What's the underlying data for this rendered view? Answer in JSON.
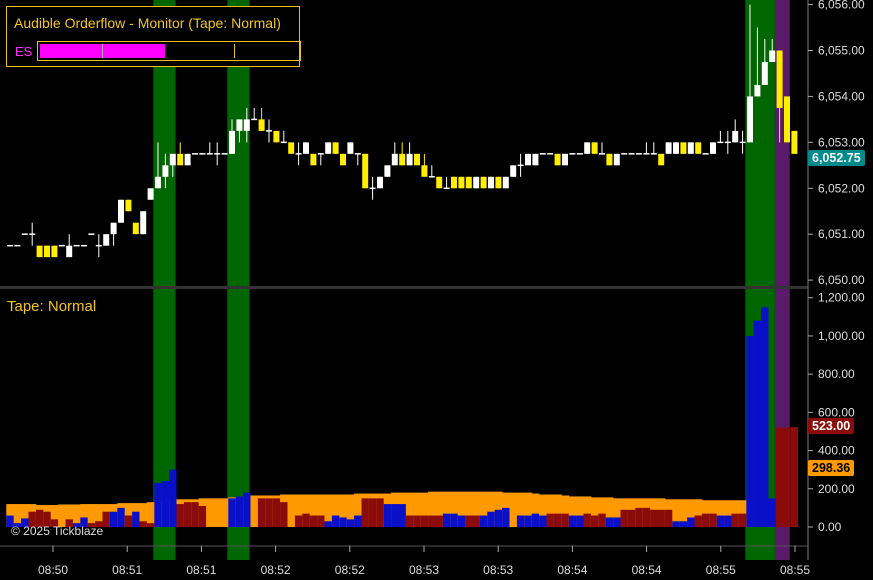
{
  "monitor": {
    "title": "Audible Orderflow - Monitor (Tape: Normal)",
    "symbol": "ES",
    "level": 0.48
  },
  "tape_label": "Tape: Normal",
  "copyright": "© 2025 Tickblaze",
  "last_price_tag": "6,052.75",
  "volume_tag_high": "523.00",
  "volume_tag_avg": "298.36",
  "colors": {
    "background": "#000000",
    "up_candle": "#ffffff",
    "down_candle": "#ffee00",
    "highlight_green": "#006600",
    "highlight_purple": "#5a1a6a",
    "volume_buy": "#0a10c8",
    "volume_sell": "#8b0a0a",
    "volume_average": "#ff9900",
    "last_price": "#008a8a"
  },
  "chart_data": [
    {
      "type": "candlestick",
      "title": "",
      "y_ticks": [
        "6,056.00",
        "6,055.00",
        "6,054.00",
        "6,053.00",
        "6,052.00",
        "6,051.00",
        "6,050.00"
      ],
      "ylim": [
        6049.85,
        6056.1
      ],
      "x_ticks": [
        "08:50",
        "08:51",
        "08:51",
        "08:52",
        "08:52",
        "08:53",
        "08:53",
        "08:54",
        "08:54",
        "08:55",
        "08:55"
      ],
      "highlight_bands": [
        {
          "start": 20,
          "end": 22,
          "color": "green"
        },
        {
          "start": 30,
          "end": 32,
          "color": "green"
        },
        {
          "start": 100,
          "end": 103,
          "color": "green"
        },
        {
          "start": 104,
          "end": 105,
          "color": "purple"
        }
      ],
      "candles": [
        [
          6050.75,
          6050.75,
          6050.75,
          6050.75
        ],
        [
          6050.75,
          6050.75,
          6050.75,
          6050.75
        ],
        [
          6051.0,
          6051.0,
          6051.0,
          6051.0
        ],
        [
          6051.0,
          6051.25,
          6050.75,
          6051.0
        ],
        [
          6050.75,
          6050.75,
          6050.5,
          6050.5
        ],
        [
          6050.75,
          6050.75,
          6050.5,
          6050.5
        ],
        [
          6050.75,
          6050.75,
          6050.5,
          6050.5
        ],
        [
          6050.75,
          6050.75,
          6050.75,
          6050.75
        ],
        [
          6050.5,
          6051.0,
          6050.5,
          6050.75
        ],
        [
          6050.75,
          6050.75,
          6050.75,
          6050.75
        ],
        [
          6050.75,
          6050.75,
          6050.75,
          6050.75
        ],
        [
          6051.0,
          6051.0,
          6051.0,
          6051.0
        ],
        [
          6050.75,
          6051.0,
          6050.5,
          6050.75
        ],
        [
          6050.75,
          6051.0,
          6050.75,
          6051.0
        ],
        [
          6051.0,
          6051.25,
          6050.75,
          6051.25
        ],
        [
          6051.25,
          6051.75,
          6051.25,
          6051.75
        ],
        [
          6051.75,
          6051.75,
          6051.5,
          6051.5
        ],
        [
          6051.25,
          6051.25,
          6051.0,
          6051.0
        ],
        [
          6051.0,
          6051.5,
          6051.0,
          6051.5
        ],
        [
          6051.75,
          6052.0,
          6051.75,
          6052.0
        ],
        [
          6052.0,
          6053.0,
          6052.0,
          6052.25
        ],
        [
          6052.25,
          6052.75,
          6052.0,
          6052.5
        ],
        [
          6052.5,
          6052.75,
          6052.25,
          6052.75
        ],
        [
          6052.75,
          6053.0,
          6052.5,
          6052.5
        ],
        [
          6052.5,
          6052.75,
          6052.5,
          6052.75
        ],
        [
          6052.75,
          6052.75,
          6052.75,
          6052.75
        ],
        [
          6052.75,
          6052.75,
          6052.75,
          6052.75
        ],
        [
          6052.75,
          6053.0,
          6052.75,
          6052.75
        ],
        [
          6052.75,
          6053.0,
          6052.5,
          6052.75
        ],
        [
          6052.75,
          6052.75,
          6052.75,
          6052.75
        ],
        [
          6052.75,
          6053.5,
          6052.75,
          6053.25
        ],
        [
          6053.25,
          6053.5,
          6053.0,
          6053.5
        ],
        [
          6053.25,
          6053.75,
          6053.0,
          6053.5
        ],
        [
          6053.5,
          6053.75,
          6053.5,
          6053.5
        ],
        [
          6053.5,
          6053.75,
          6053.25,
          6053.25
        ],
        [
          6053.25,
          6053.5,
          6053.0,
          6053.25
        ],
        [
          6053.25,
          6053.25,
          6053.0,
          6053.0
        ],
        [
          6053.0,
          6053.25,
          6053.0,
          6053.0
        ],
        [
          6053.0,
          6053.0,
          6052.75,
          6052.75
        ],
        [
          6052.75,
          6053.0,
          6052.5,
          6052.75
        ],
        [
          6052.75,
          6053.0,
          6052.75,
          6053.0
        ],
        [
          6052.75,
          6052.75,
          6052.5,
          6052.5
        ],
        [
          6052.75,
          6052.75,
          6052.5,
          6052.75
        ],
        [
          6052.75,
          6053.0,
          6052.75,
          6053.0
        ],
        [
          6053.0,
          6053.0,
          6052.75,
          6052.75
        ],
        [
          6052.75,
          6052.75,
          6052.5,
          6052.5
        ],
        [
          6052.75,
          6053.0,
          6052.75,
          6053.0
        ],
        [
          6052.75,
          6052.75,
          6052.5,
          6052.75
        ],
        [
          6052.75,
          6052.75,
          6052.0,
          6052.0
        ],
        [
          6052.0,
          6052.25,
          6051.75,
          6052.0
        ],
        [
          6052.0,
          6052.25,
          6052.0,
          6052.25
        ],
        [
          6052.25,
          6052.5,
          6052.25,
          6052.5
        ],
        [
          6052.5,
          6053.0,
          6052.5,
          6052.75
        ],
        [
          6052.75,
          6053.0,
          6052.5,
          6052.5
        ],
        [
          6052.5,
          6053.0,
          6052.5,
          6052.75
        ],
        [
          6052.75,
          6052.75,
          6052.5,
          6052.5
        ],
        [
          6052.5,
          6052.75,
          6052.25,
          6052.25
        ],
        [
          6052.25,
          6052.5,
          6052.25,
          6052.25
        ],
        [
          6052.25,
          6052.25,
          6052.0,
          6052.0
        ],
        [
          6052.0,
          6052.25,
          6052.0,
          6052.0
        ],
        [
          6052.25,
          6052.25,
          6052.0,
          6052.0
        ],
        [
          6052.25,
          6052.25,
          6052.0,
          6052.0
        ],
        [
          6052.25,
          6052.25,
          6052.0,
          6052.0
        ],
        [
          6052.0,
          6052.25,
          6052.0,
          6052.25
        ],
        [
          6052.25,
          6052.25,
          6052.0,
          6052.0
        ],
        [
          6052.0,
          6052.25,
          6052.0,
          6052.25
        ],
        [
          6052.25,
          6052.25,
          6052.0,
          6052.0
        ],
        [
          6052.0,
          6052.25,
          6052.0,
          6052.25
        ],
        [
          6052.25,
          6052.5,
          6052.25,
          6052.5
        ],
        [
          6052.5,
          6052.75,
          6052.25,
          6052.5
        ],
        [
          6052.5,
          6052.75,
          6052.5,
          6052.75
        ],
        [
          6052.5,
          6052.75,
          6052.5,
          6052.75
        ],
        [
          6052.75,
          6052.75,
          6052.75,
          6052.75
        ],
        [
          6052.75,
          6052.75,
          6052.75,
          6052.75
        ],
        [
          6052.75,
          6052.75,
          6052.5,
          6052.5
        ],
        [
          6052.5,
          6052.75,
          6052.5,
          6052.75
        ],
        [
          6052.75,
          6052.75,
          6052.75,
          6052.75
        ],
        [
          6052.75,
          6052.75,
          6052.75,
          6052.75
        ],
        [
          6052.75,
          6053.0,
          6052.75,
          6053.0
        ],
        [
          6053.0,
          6053.0,
          6052.75,
          6052.75
        ],
        [
          6052.75,
          6053.0,
          6052.75,
          6052.75
        ],
        [
          6052.75,
          6052.75,
          6052.5,
          6052.5
        ],
        [
          6052.5,
          6052.75,
          6052.5,
          6052.75
        ],
        [
          6052.75,
          6052.75,
          6052.75,
          6052.75
        ],
        [
          6052.75,
          6052.75,
          6052.75,
          6052.75
        ],
        [
          6052.75,
          6052.75,
          6052.75,
          6052.75
        ],
        [
          6052.75,
          6053.0,
          6052.75,
          6052.75
        ],
        [
          6052.75,
          6053.0,
          6052.75,
          6052.75
        ],
        [
          6052.75,
          6052.75,
          6052.5,
          6052.5
        ],
        [
          6052.75,
          6053.0,
          6052.75,
          6053.0
        ],
        [
          6052.75,
          6053.0,
          6052.75,
          6053.0
        ],
        [
          6053.0,
          6053.0,
          6052.75,
          6052.75
        ],
        [
          6052.75,
          6053.0,
          6052.75,
          6053.0
        ],
        [
          6053.0,
          6053.0,
          6052.75,
          6052.75
        ],
        [
          6052.75,
          6052.75,
          6052.75,
          6052.75
        ],
        [
          6052.75,
          6053.0,
          6052.75,
          6053.0
        ],
        [
          6053.0,
          6053.25,
          6053.0,
          6053.0
        ],
        [
          6053.0,
          6053.25,
          6052.75,
          6053.0
        ],
        [
          6053.0,
          6053.5,
          6053.0,
          6053.25
        ],
        [
          6053.0,
          6053.25,
          6052.75,
          6053.0
        ],
        [
          6053.0,
          6056.0,
          6053.0,
          6054.0
        ],
        [
          6054.0,
          6055.5,
          6054.0,
          6054.25
        ],
        [
          6054.25,
          6055.25,
          6054.25,
          6054.75
        ],
        [
          6054.75,
          6055.25,
          6054.75,
          6055.0
        ],
        [
          6055.0,
          6055.0,
          6053.0,
          6053.75
        ],
        [
          6054.0,
          6054.0,
          6053.0,
          6053.0
        ],
        [
          6053.25,
          6053.25,
          6052.75,
          6052.75
        ]
      ]
    },
    {
      "type": "bar",
      "title": "Tape: Normal",
      "y_ticks": [
        "1,200.00",
        "1,000.00",
        "800.00",
        "600.00",
        "400.00",
        "200.00",
        "0.00"
      ],
      "ylim": [
        0,
        1230
      ],
      "series": [
        {
          "name": "",
          "kind": "buy",
          "values": [
            60,
            20,
            45,
            0,
            0,
            0,
            0,
            0,
            0,
            20,
            50,
            0,
            0,
            0,
            80,
            100,
            0,
            80,
            0,
            0,
            230,
            240,
            300,
            0,
            0,
            0,
            0,
            0,
            0,
            0,
            150,
            160,
            180,
            0,
            0,
            0,
            0,
            0,
            0,
            0,
            0,
            0,
            0,
            30,
            60,
            50,
            40,
            60,
            0,
            0,
            0,
            120,
            120,
            120,
            0,
            0,
            0,
            0,
            0,
            70,
            70,
            60,
            0,
            0,
            60,
            80,
            90,
            100,
            0,
            60,
            60,
            70,
            60,
            0,
            0,
            0,
            60,
            60,
            0,
            0,
            0,
            50,
            50,
            0,
            0,
            0,
            0,
            0,
            0,
            0,
            30,
            30,
            50,
            0,
            0,
            0,
            60,
            60,
            0,
            0,
            1000,
            1080,
            1150,
            150,
            0,
            0,
            0
          ]
        },
        {
          "name": "",
          "kind": "sell",
          "values": [
            0,
            0,
            0,
            80,
            90,
            80,
            40,
            0,
            40,
            0,
            0,
            20,
            30,
            80,
            0,
            0,
            60,
            0,
            30,
            20,
            0,
            0,
            0,
            120,
            130,
            130,
            110,
            0,
            0,
            0,
            0,
            0,
            0,
            0,
            150,
            150,
            150,
            130,
            0,
            60,
            70,
            60,
            60,
            0,
            0,
            0,
            0,
            0,
            150,
            150,
            150,
            0,
            0,
            0,
            60,
            60,
            60,
            60,
            60,
            0,
            0,
            0,
            60,
            60,
            0,
            0,
            0,
            0,
            0,
            0,
            0,
            0,
            0,
            70,
            70,
            70,
            0,
            0,
            70,
            60,
            70,
            0,
            0,
            90,
            90,
            100,
            100,
            90,
            90,
            90,
            0,
            0,
            0,
            60,
            70,
            70,
            0,
            0,
            70,
            70,
            0,
            0,
            0,
            0,
            520,
            520,
            523
          ]
        },
        {
          "name": "",
          "kind": "average",
          "values": [
            120,
            120,
            120,
            120,
            115,
            115,
            115,
            118,
            118,
            118,
            120,
            120,
            120,
            120,
            120,
            125,
            125,
            125,
            125,
            130,
            130,
            130,
            140,
            145,
            145,
            145,
            150,
            150,
            150,
            150,
            155,
            155,
            160,
            165,
            165,
            165,
            165,
            170,
            170,
            170,
            170,
            170,
            170,
            170,
            170,
            170,
            170,
            175,
            175,
            175,
            175,
            175,
            180,
            180,
            180,
            180,
            180,
            185,
            185,
            185,
            185,
            185,
            185,
            185,
            185,
            185,
            185,
            180,
            180,
            180,
            180,
            175,
            170,
            170,
            170,
            165,
            160,
            160,
            160,
            155,
            155,
            155,
            150,
            150,
            150,
            150,
            150,
            150,
            150,
            145,
            145,
            145,
            145,
            145,
            140,
            140,
            140,
            140,
            140,
            140,
            0,
            0,
            0,
            0,
            0,
            0,
            0
          ]
        }
      ]
    }
  ]
}
